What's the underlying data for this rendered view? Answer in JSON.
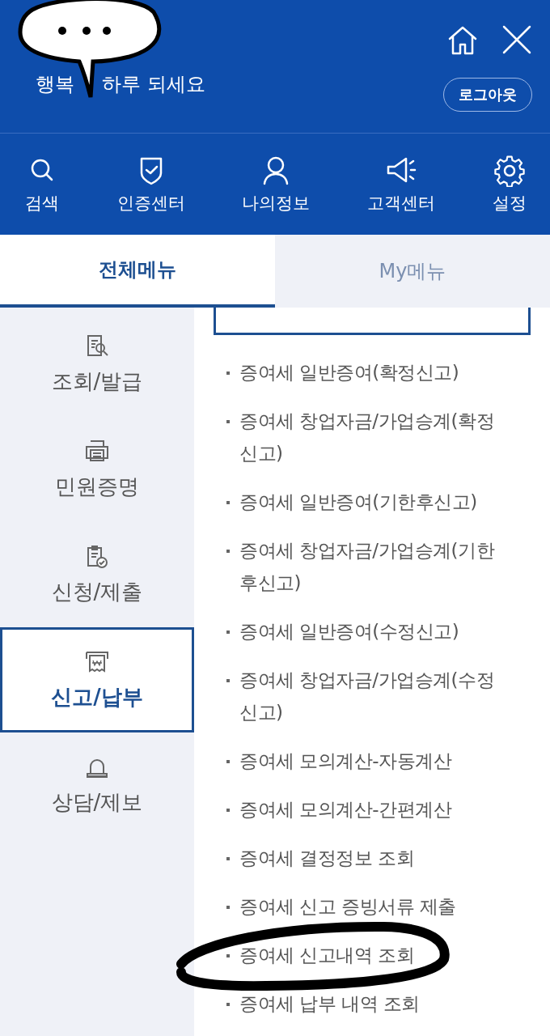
{
  "header": {
    "greeting_start": "행복",
    "greeting_end": "하루 되세요",
    "logout": "로그아웃"
  },
  "quick_menu": [
    {
      "kind": "search",
      "label": "검색"
    },
    {
      "kind": "shield",
      "label": "인증센터"
    },
    {
      "kind": "person",
      "label": "나의정보"
    },
    {
      "kind": "megaphone",
      "label": "고객센터"
    },
    {
      "kind": "gear",
      "label": "설정"
    }
  ],
  "tabs": [
    {
      "label": "전체메뉴",
      "selected": true
    },
    {
      "label": "My메뉴",
      "selected": false
    }
  ],
  "sidebar": [
    {
      "kind": "inquiry",
      "label": "조회/발급",
      "selected": false
    },
    {
      "kind": "printer",
      "label": "민원증명",
      "selected": false
    },
    {
      "kind": "clipboard",
      "label": "신청/제출",
      "selected": false
    },
    {
      "kind": "receipt",
      "label": "신고/납부",
      "selected": true
    },
    {
      "kind": "siren",
      "label": "상담/제보",
      "selected": false
    }
  ],
  "items": [
    {
      "text": "증여세 일반증여(확정신고)",
      "circled": false
    },
    {
      "text": "증여세 창업자금/가업승계(확정신고)",
      "circled": false
    },
    {
      "text": "증여세 일반증여(기한후신고)",
      "circled": false
    },
    {
      "text": "증여세 창업자금/가업승계(기한후신고)",
      "circled": false
    },
    {
      "text": "증여세 일반증여(수정신고)",
      "circled": false
    },
    {
      "text": "증여세 창업자금/가업승계(수정신고)",
      "circled": false
    },
    {
      "text": "증여세 모의계산-자동계산",
      "circled": false
    },
    {
      "text": "증여세 모의계산-간편계산",
      "circled": false
    },
    {
      "text": "증여세 결정정보 조회",
      "circled": false
    },
    {
      "text": "증여세 신고 증빙서류 제출",
      "circled": false
    },
    {
      "text": "증여세 신고내역 조회",
      "circled": true
    },
    {
      "text": "증여세 납부 내역 조회",
      "circled": false
    }
  ]
}
